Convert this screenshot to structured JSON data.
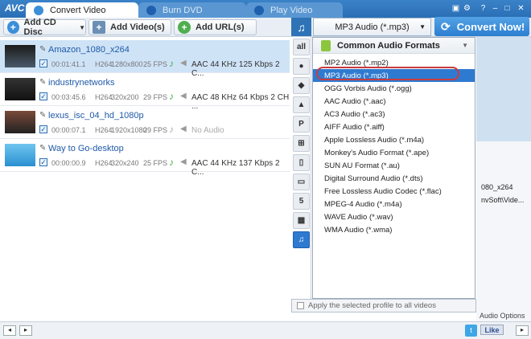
{
  "app": {
    "logo": "AVC"
  },
  "tabs": [
    {
      "label": "Convert Video",
      "active": true
    },
    {
      "label": "Burn DVD",
      "active": false
    },
    {
      "label": "Play Video",
      "active": false
    }
  ],
  "toolbar": {
    "add_cd_disc": "Add CD Disc",
    "add_videos": "Add Video(s)",
    "add_urls": "Add URL(s)"
  },
  "profile_select": "MP3 Audio (*.mp3)",
  "convert_button": "Convert Now!",
  "files": [
    {
      "name": "Amazon_1080_x264",
      "duration": "00:01:41.1",
      "codec": "H264",
      "resolution": "1280x800",
      "fps": "25 FPS",
      "audio": "AAC 44 KHz 125 Kbps 2 C...",
      "selected": true
    },
    {
      "name": "industrynetworks",
      "duration": "00:03:45.6",
      "codec": "H264",
      "resolution": "320x200",
      "fps": "29 FPS",
      "audio": "AAC 48 KHz 64 Kbps 2 CH ...",
      "selected": false
    },
    {
      "name": "lexus_isc_04_hd_1080p",
      "duration": "00:00:07.1",
      "codec": "H264",
      "resolution": "1920x1080",
      "fps": "29 FPS",
      "audio": "No Audio",
      "selected": false
    },
    {
      "name": "Way to Go-desktop",
      "duration": "00:00:00.9",
      "codec": "H264",
      "resolution": "320x240",
      "fps": "25 FPS",
      "audio": "AAC 44 KHz 137 Kbps 2 C...",
      "selected": false
    }
  ],
  "format_menu": {
    "header": "Common Audio Formats",
    "items": [
      "MP2 Audio (*.mp2)",
      "MP3 Audio (*.mp3)",
      "OGG Vorbis Audio (*.ogg)",
      "AAC Audio (*.aac)",
      "AC3 Audio (*.ac3)",
      "AIFF Audio (*.aiff)",
      "Apple Lossless Audio (*.m4a)",
      "Monkey's Audio Format (*.ape)",
      "SUN AU Format (*.au)",
      "Digital Surround Audio (*.dts)",
      "Free Lossless Audio Codec (*.flac)",
      "MPEG-4 Audio (*.m4a)",
      "WAVE Audio (*.wav)",
      "WMA Audio (*.wma)"
    ],
    "highlighted": "MP3 Audio (*.mp3)",
    "footer": "Apply the selected profile to all videos"
  },
  "right_pane": {
    "text1": "080_x264",
    "text2": "nvSoft\\Vide...",
    "text3": "Audio Options"
  },
  "bottom": {
    "like": "Like"
  },
  "colors": {
    "accent": "#2f7ad1",
    "highlight_ring": "#c93c3c"
  }
}
